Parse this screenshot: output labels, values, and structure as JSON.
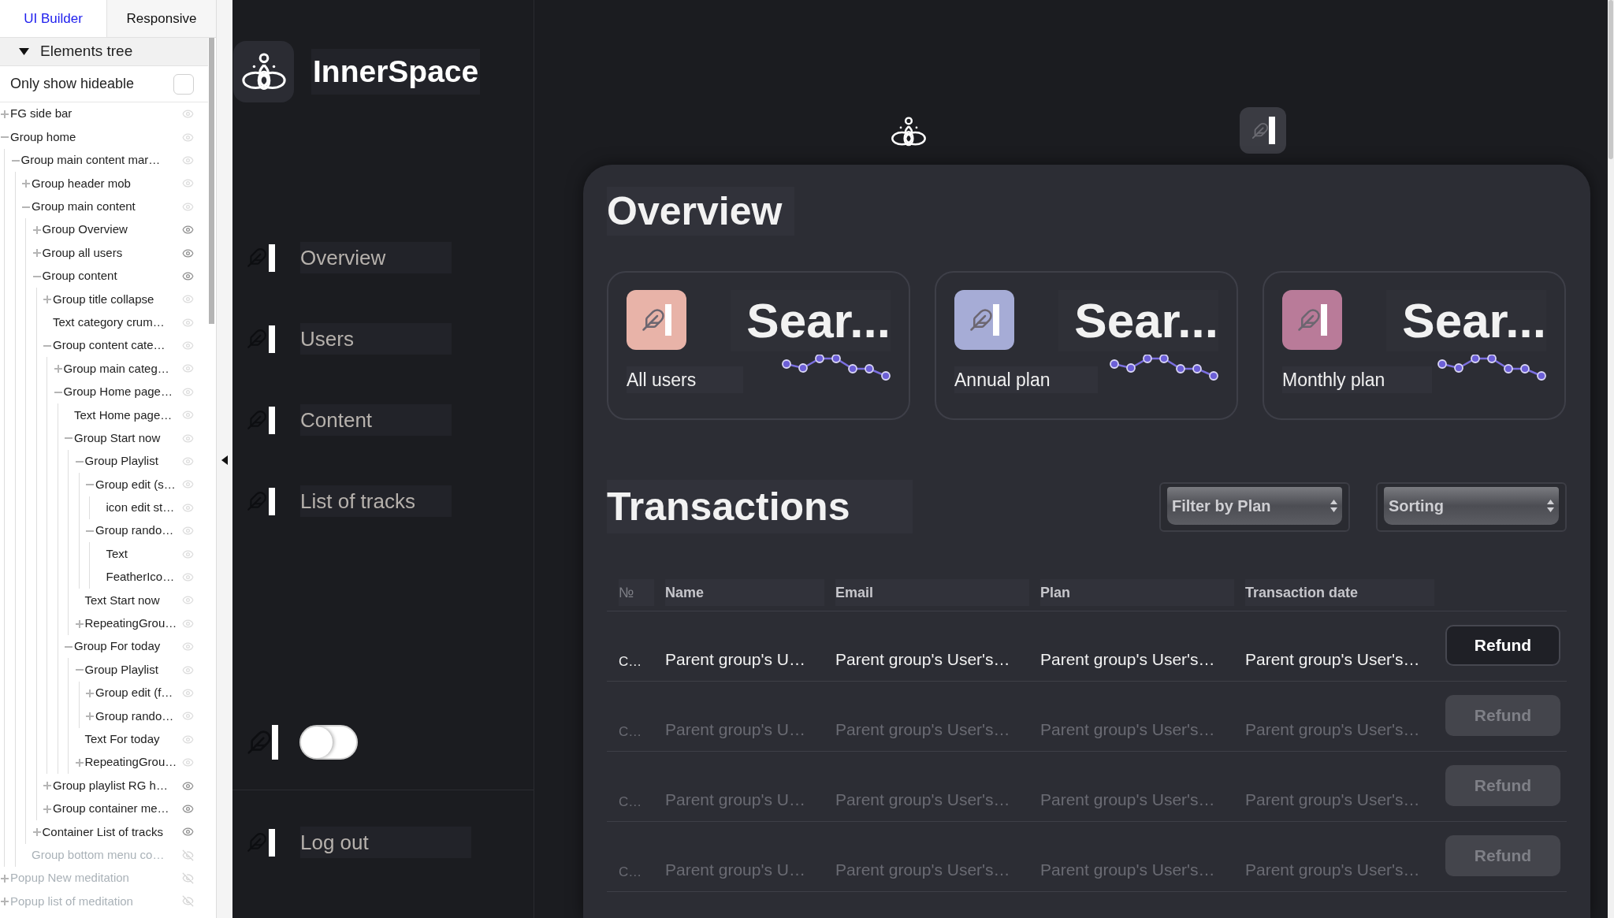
{
  "builder": {
    "tabs": [
      {
        "label": "UI Builder",
        "selected": true
      },
      {
        "label": "Responsive",
        "selected": false
      }
    ],
    "tree_header": {
      "label": "Elements tree",
      "expanded": true
    },
    "filter": {
      "label": "Only show hideable",
      "checked": false
    },
    "tree": [
      {
        "label": "FG side bar",
        "expanded": false,
        "hidden": false,
        "shown": false
      },
      {
        "label": "Group home",
        "expanded": true,
        "hidden": false,
        "shown": false,
        "children": [
          {
            "label": "Group main content mar…",
            "expanded": true,
            "hidden": false,
            "shown": false,
            "children": [
              {
                "label": "Group header mob",
                "expanded": false,
                "hidden": false,
                "shown": false
              },
              {
                "label": "Group main content",
                "expanded": true,
                "hidden": false,
                "shown": false,
                "children": [
                  {
                    "label": "Group Overview",
                    "expanded": false,
                    "hidden": false,
                    "shown": true
                  },
                  {
                    "label": "Group all users",
                    "expanded": false,
                    "hidden": false,
                    "shown": true
                  },
                  {
                    "label": "Group content",
                    "expanded": true,
                    "hidden": false,
                    "shown": true,
                    "children": [
                      {
                        "label": "Group title collapse",
                        "expanded": false,
                        "hidden": false,
                        "shown": false
                      },
                      {
                        "label": "Text category crum…",
                        "hidden": false,
                        "shown": false
                      },
                      {
                        "label": "Group content cate…",
                        "expanded": true,
                        "hidden": false,
                        "shown": false,
                        "children": [
                          {
                            "label": "Group main categ…",
                            "expanded": false,
                            "hidden": false,
                            "shown": false
                          },
                          {
                            "label": "Group Home page…",
                            "expanded": true,
                            "hidden": false,
                            "shown": false,
                            "children": [
                              {
                                "label": "Text Home page…",
                                "hidden": false,
                                "shown": false
                              },
                              {
                                "label": "Group Start now",
                                "expanded": true,
                                "hidden": false,
                                "shown": false,
                                "children": [
                                  {
                                    "label": "Group Playlist",
                                    "expanded": true,
                                    "hidden": false,
                                    "shown": false,
                                    "children": [
                                      {
                                        "label": "Group edit (s…",
                                        "expanded": true,
                                        "hidden": false,
                                        "shown": false,
                                        "children": [
                                          {
                                            "label": "icon edit st…",
                                            "hidden": false,
                                            "shown": false
                                          }
                                        ]
                                      },
                                      {
                                        "label": "Group rando…",
                                        "expanded": true,
                                        "hidden": false,
                                        "shown": false,
                                        "children": [
                                          {
                                            "label": "Text",
                                            "hidden": false,
                                            "shown": false
                                          },
                                          {
                                            "label": "FeatherIco…",
                                            "hidden": false,
                                            "shown": false
                                          }
                                        ]
                                      }
                                    ]
                                  },
                                  {
                                    "label": "Text Start now",
                                    "hidden": false,
                                    "shown": false
                                  },
                                  {
                                    "label": "RepeatingGrou…",
                                    "expanded": false,
                                    "hidden": false,
                                    "shown": false
                                  }
                                ]
                              },
                              {
                                "label": "Group For today",
                                "expanded": true,
                                "hidden": false,
                                "shown": false,
                                "children": [
                                  {
                                    "label": "Group Playlist",
                                    "expanded": true,
                                    "hidden": false,
                                    "shown": false,
                                    "children": [
                                      {
                                        "label": "Group edit (f…",
                                        "expanded": false,
                                        "hidden": false,
                                        "shown": false
                                      },
                                      {
                                        "label": "Group rando…",
                                        "expanded": false,
                                        "hidden": false,
                                        "shown": false
                                      }
                                    ]
                                  },
                                  {
                                    "label": "Text For today",
                                    "hidden": false,
                                    "shown": false
                                  },
                                  {
                                    "label": "RepeatingGrou…",
                                    "expanded": false,
                                    "hidden": false,
                                    "shown": false
                                  }
                                ]
                              }
                            ]
                          }
                        ]
                      },
                      {
                        "label": "Group playlist RG h…",
                        "expanded": false,
                        "hidden": false,
                        "shown": true
                      },
                      {
                        "label": "Group container me…",
                        "expanded": false,
                        "hidden": false,
                        "shown": true
                      }
                    ]
                  },
                  {
                    "label": "Container List of tracks",
                    "expanded": false,
                    "hidden": false,
                    "shown": true
                  }
                ]
              },
              {
                "label": "Group bottom menu co…",
                "hidden": true,
                "shown": false
              }
            ]
          }
        ]
      },
      {
        "label": "Popup New meditation",
        "expanded": false,
        "hidden": true,
        "shown": false
      },
      {
        "label": "Popup list of meditation",
        "expanded": false,
        "hidden": true,
        "shown": false
      }
    ]
  },
  "app": {
    "brand": "InnerSpace",
    "nav": [
      {
        "label": "Overview"
      },
      {
        "label": "Users"
      },
      {
        "label": "Content"
      },
      {
        "label": "List of tracks"
      }
    ],
    "theme_toggle": {
      "on": false
    },
    "logout": "Log out",
    "overview": {
      "title": "Overview",
      "stats": [
        {
          "value": "Sear...",
          "label": "All users",
          "color": "#e8b3a8"
        },
        {
          "value": "Sear...",
          "label": "Annual plan",
          "color": "#a6acd6"
        },
        {
          "value": "Sear...",
          "label": "Monthly plan",
          "color": "#b97b99"
        }
      ]
    },
    "transactions": {
      "title": "Transactions",
      "filters": [
        {
          "placeholder": "Filter by Plan"
        },
        {
          "placeholder": "Sorting"
        }
      ],
      "columns": [
        "№",
        "Name",
        "Email",
        "Plan",
        "Transaction date"
      ],
      "rows": [
        {
          "cells": [
            "C…",
            "Parent group's U…",
            "Parent group's User's…",
            "Parent group's User's…",
            "Parent group's User's…"
          ],
          "action": "Refund",
          "disabled": false
        },
        {
          "cells": [
            "C…",
            "Parent group's U…",
            "Parent group's User's…",
            "Parent group's User's…",
            "Parent group's User's…"
          ],
          "action": "Refund",
          "disabled": true
        },
        {
          "cells": [
            "C…",
            "Parent group's U…",
            "Parent group's User's…",
            "Parent group's User's…",
            "Parent group's User's…"
          ],
          "action": "Refund",
          "disabled": true
        },
        {
          "cells": [
            "C…",
            "Parent group's U…",
            "Parent group's User's…",
            "Parent group's User's…",
            "Parent group's User's…"
          ],
          "action": "Refund",
          "disabled": true
        }
      ]
    }
  }
}
